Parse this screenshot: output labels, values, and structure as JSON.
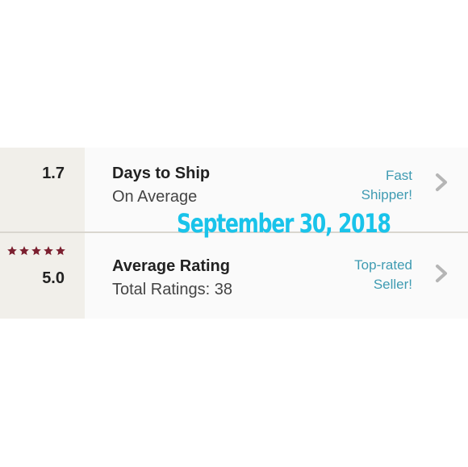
{
  "shipping": {
    "value": "1.7",
    "title": "Days to Ship",
    "subtitle": "On Average",
    "badge_line1": "Fast",
    "badge_line2": "Shipper!",
    "chevron_icon": "chevron-right-icon"
  },
  "rating": {
    "stars_filled": 5,
    "stars_total": 5,
    "star_icon": "star-icon",
    "value": "5.0",
    "title": "Average Rating",
    "subtitle": "Total Ratings: 38",
    "badge_line1": "Top-rated",
    "badge_line2": "Seller!",
    "chevron_icon": "chevron-right-icon"
  },
  "overlay": {
    "date": "September 30, 2018"
  },
  "colors": {
    "accent": "#3f9bb2",
    "star": "#7b1f2f",
    "overlay": "#19c3ea",
    "left_panel": "#f1efea"
  }
}
